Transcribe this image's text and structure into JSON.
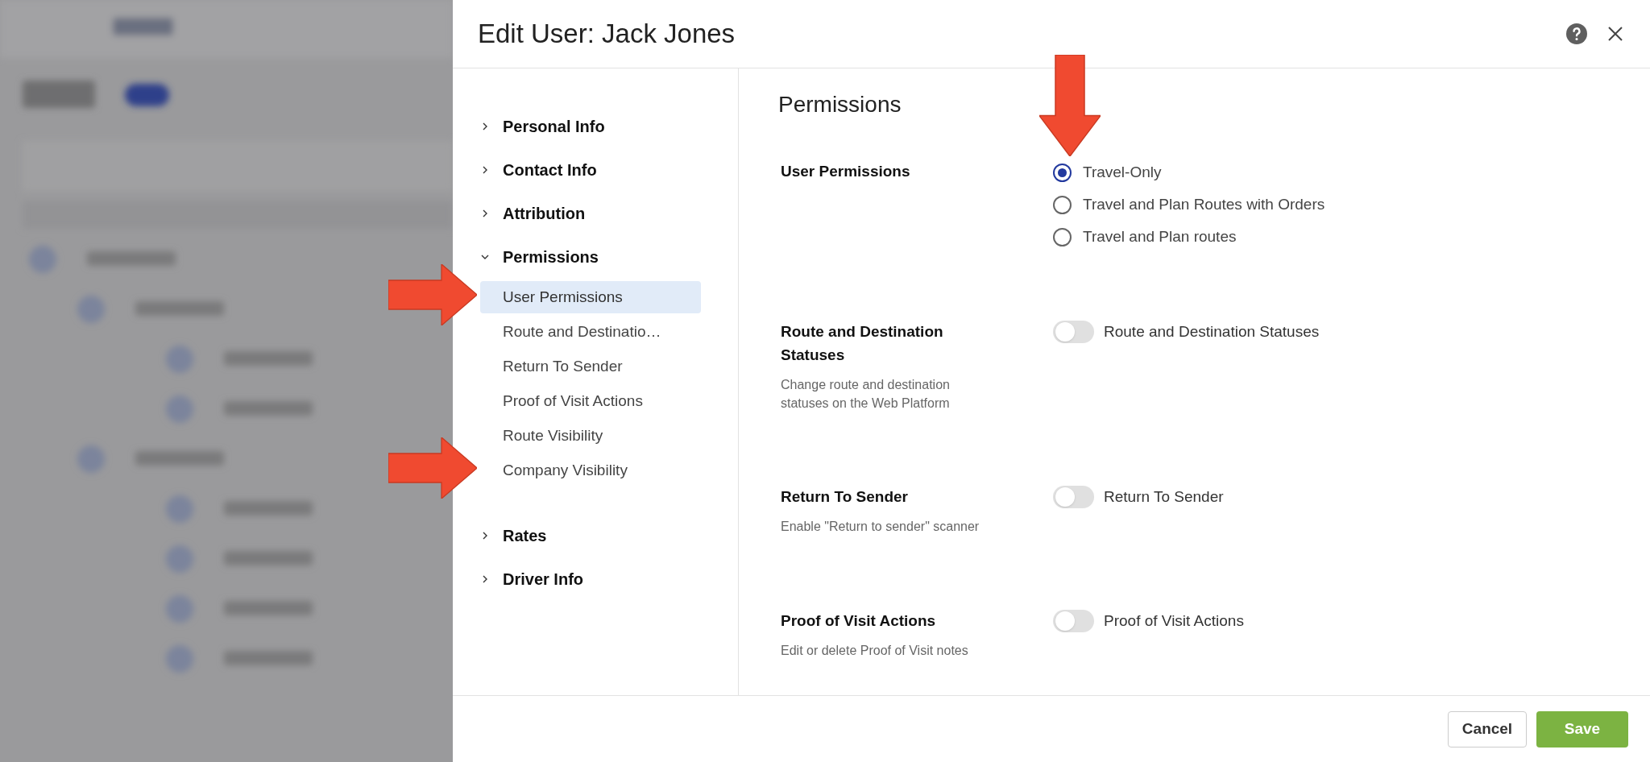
{
  "dialog": {
    "title": "Edit User: Jack Jones"
  },
  "nav": [
    {
      "label": "Personal Info",
      "expanded": false
    },
    {
      "label": "Contact Info",
      "expanded": false
    },
    {
      "label": "Attribution",
      "expanded": false
    },
    {
      "label": "Permissions",
      "expanded": true,
      "children": [
        {
          "label": "User Permissions",
          "selected": true
        },
        {
          "label": "Route and Destinatio…",
          "selected": false
        },
        {
          "label": "Return To Sender",
          "selected": false
        },
        {
          "label": "Proof of Visit Actions",
          "selected": false
        },
        {
          "label": "Route Visibility",
          "selected": false
        },
        {
          "label": "Company Visibility",
          "selected": false
        }
      ]
    },
    {
      "label": "Rates",
      "expanded": false
    },
    {
      "label": "Driver Info",
      "expanded": false
    }
  ],
  "section": {
    "title": "Permissions",
    "settings": [
      {
        "kind": "radio",
        "label": "User Permissions",
        "options": [
          {
            "label": "Travel-Only",
            "selected": true
          },
          {
            "label": "Travel and Plan Routes with Orders",
            "selected": false
          },
          {
            "label": "Travel and Plan routes",
            "selected": false
          }
        ]
      },
      {
        "kind": "toggle",
        "label": "Route and Destination Statuses",
        "description": "Change route and destination statuses on the Web Platform",
        "toggle_label": "Route and Destination Statuses",
        "on": false
      },
      {
        "kind": "toggle",
        "label": "Return To Sender",
        "description": "Enable \"Return to sender\" scanner",
        "toggle_label": "Return To Sender",
        "on": false
      },
      {
        "kind": "toggle",
        "label": "Proof of Visit Actions",
        "description": "Edit or delete Proof of Visit notes",
        "toggle_label": "Proof of Visit Actions",
        "on": false
      }
    ]
  },
  "footer": {
    "buttons": [
      {
        "kind": "secondary",
        "label": "Cancel"
      },
      {
        "kind": "primary",
        "label": "Save"
      }
    ]
  }
}
